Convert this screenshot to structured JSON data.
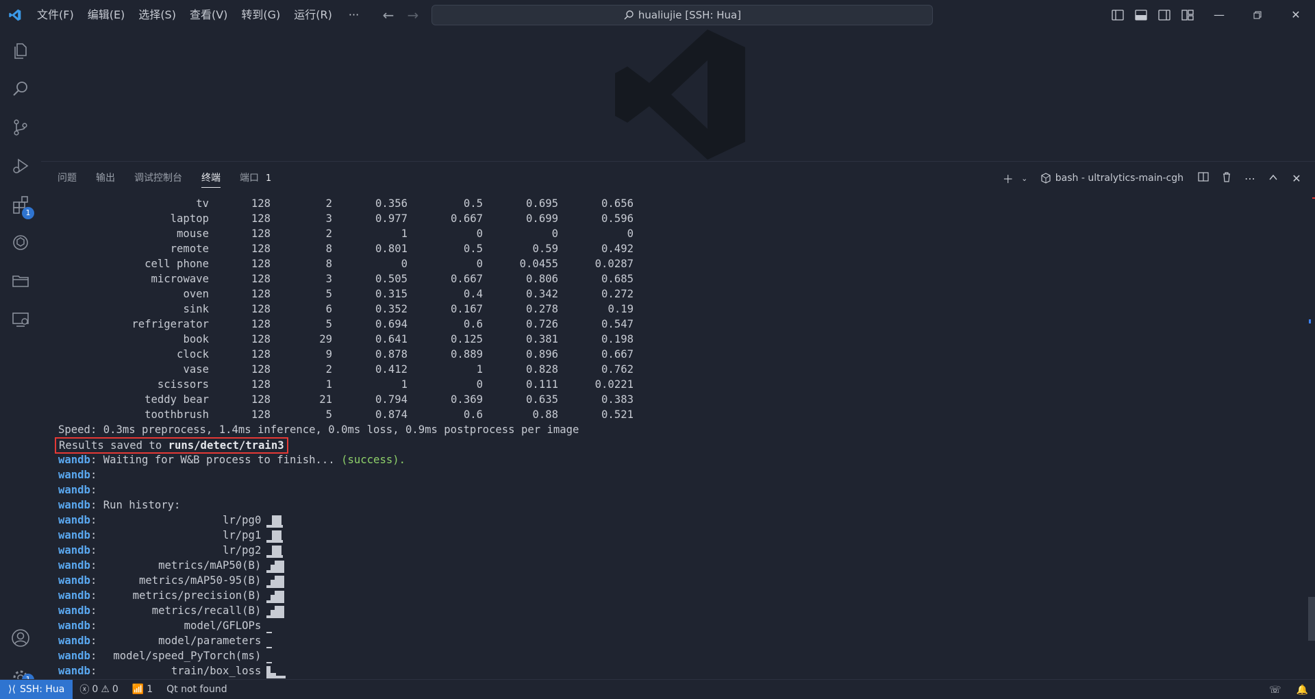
{
  "colors": {
    "accent": "#2f74d0",
    "wandb": "#5aa8f0",
    "success": "#8fd16a",
    "highlight_box": "#e53935"
  },
  "menu": [
    "文件(F)",
    "编辑(E)",
    "选择(S)",
    "查看(V)",
    "转到(G)",
    "运行(R)"
  ],
  "menu_more": "···",
  "command_center": "hualiujie [SSH: Hua]",
  "activity_badges": {
    "extensions": "1",
    "settings": "1"
  },
  "panel": {
    "tabs": [
      "问题",
      "输出",
      "调试控制台",
      "终端",
      "端口"
    ],
    "active_tab": "终端",
    "ports_count": "1",
    "terminal_name": "bash - ultralytics-main-cgh"
  },
  "terminal": {
    "rows": [
      [
        "tv",
        "128",
        "2",
        "0.356",
        "0.5",
        "0.695",
        "0.656"
      ],
      [
        "laptop",
        "128",
        "3",
        "0.977",
        "0.667",
        "0.699",
        "0.596"
      ],
      [
        "mouse",
        "128",
        "2",
        "1",
        "0",
        "0",
        "0"
      ],
      [
        "remote",
        "128",
        "8",
        "0.801",
        "0.5",
        "0.59",
        "0.492"
      ],
      [
        "cell phone",
        "128",
        "8",
        "0",
        "0",
        "0.0455",
        "0.0287"
      ],
      [
        "microwave",
        "128",
        "3",
        "0.505",
        "0.667",
        "0.806",
        "0.685"
      ],
      [
        "oven",
        "128",
        "5",
        "0.315",
        "0.4",
        "0.342",
        "0.272"
      ],
      [
        "sink",
        "128",
        "6",
        "0.352",
        "0.167",
        "0.278",
        "0.19"
      ],
      [
        "refrigerator",
        "128",
        "5",
        "0.694",
        "0.6",
        "0.726",
        "0.547"
      ],
      [
        "book",
        "128",
        "29",
        "0.641",
        "0.125",
        "0.381",
        "0.198"
      ],
      [
        "clock",
        "128",
        "9",
        "0.878",
        "0.889",
        "0.896",
        "0.667"
      ],
      [
        "vase",
        "128",
        "2",
        "0.412",
        "1",
        "0.828",
        "0.762"
      ],
      [
        "scissors",
        "128",
        "1",
        "1",
        "0",
        "0.111",
        "0.0221"
      ],
      [
        "teddy bear",
        "128",
        "21",
        "0.794",
        "0.369",
        "0.635",
        "0.383"
      ],
      [
        "toothbrush",
        "128",
        "5",
        "0.874",
        "0.6",
        "0.88",
        "0.521"
      ]
    ],
    "speed_line": "Speed: 0.3ms preprocess, 1.4ms inference, 0.0ms loss, 0.9ms postprocess per image",
    "results_prefix": "Results saved to ",
    "results_path": "runs/detect/train3",
    "wandb_prefix": "wandb",
    "waiting_text": " Waiting for W&B process to finish... ",
    "success_text": "(success).",
    "run_history": " Run history:",
    "history": [
      {
        "label": "lr/pg0",
        "spark": "step-up"
      },
      {
        "label": "lr/pg1",
        "spark": "step-up"
      },
      {
        "label": "lr/pg2",
        "spark": "step-up"
      },
      {
        "label": "metrics/mAP50(B)",
        "spark": "rise"
      },
      {
        "label": "metrics/mAP50-95(B)",
        "spark": "rise"
      },
      {
        "label": "metrics/precision(B)",
        "spark": "rise"
      },
      {
        "label": "metrics/recall(B)",
        "spark": "rise"
      },
      {
        "label": "model/GFLOPs",
        "spark": "flat"
      },
      {
        "label": "model/parameters",
        "spark": "flat"
      },
      {
        "label": "model/speed_PyTorch(ms)",
        "spark": "flat"
      },
      {
        "label": "train/box_loss",
        "spark": "fall"
      }
    ]
  },
  "statusbar": {
    "remote": "SSH: Hua",
    "errors": "0",
    "warnings": "0",
    "ports": "1",
    "qt": "Qt not found"
  }
}
